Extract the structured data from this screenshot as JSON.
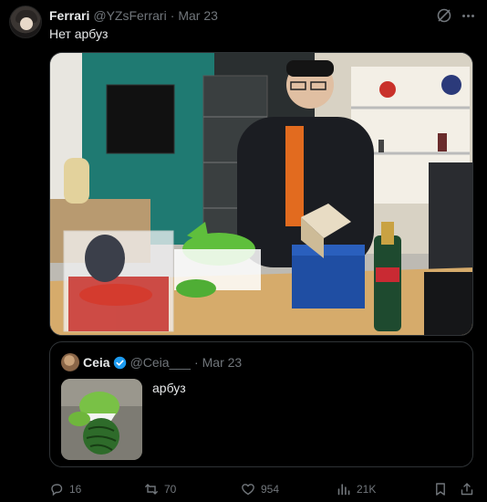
{
  "post": {
    "author": {
      "name": "Ferrari",
      "handle": "@YZsFerrari",
      "separator": "·",
      "date": "Mar 23"
    },
    "text": "Нет арбуз"
  },
  "quote": {
    "author": {
      "name": "Ceia",
      "handle": "@Ceia___",
      "separator": "·",
      "date": "Mar 23",
      "verified": true
    },
    "text": "арбуз"
  },
  "actions": {
    "replies": "16",
    "reposts": "70",
    "likes": "954",
    "views": "21K"
  },
  "colors": {
    "background": "#000000",
    "text_primary": "#e7e9ea",
    "text_secondary": "#71767b",
    "border": "#2f3336",
    "verified_blue": "#1d9bf0"
  },
  "icons": [
    "grok-icon",
    "more-icon",
    "reply-icon",
    "repost-icon",
    "like-icon",
    "views-icon",
    "bookmark-icon",
    "share-icon",
    "verified-badge-icon"
  ]
}
